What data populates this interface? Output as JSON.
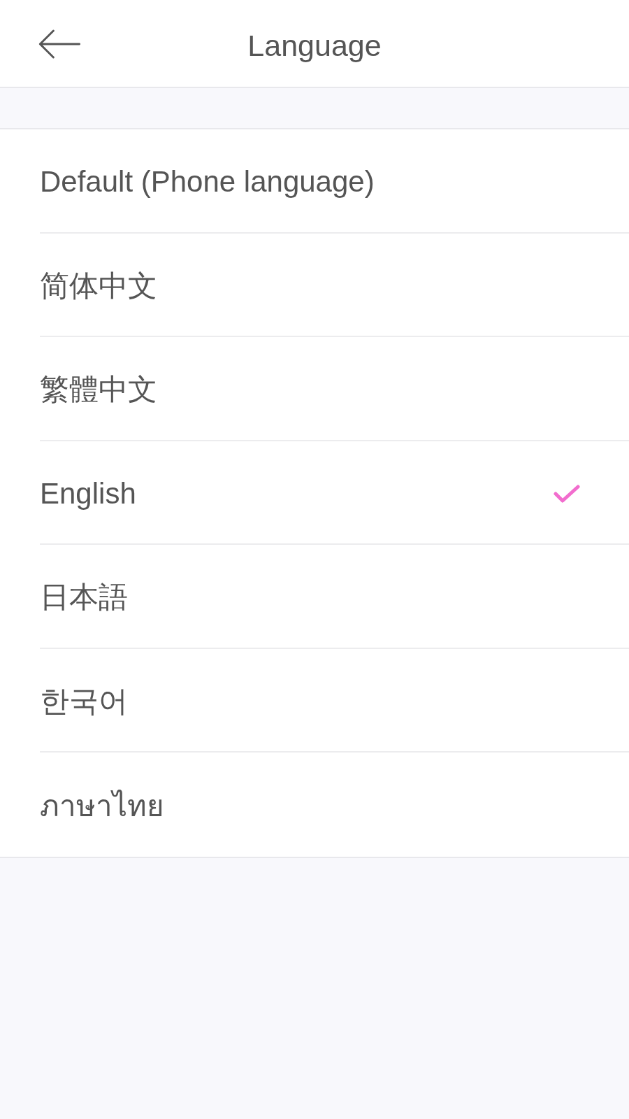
{
  "header": {
    "title": "Language"
  },
  "languages": [
    {
      "label": "Default (Phone language)",
      "selected": false
    },
    {
      "label": "简体中文",
      "selected": false
    },
    {
      "label": "繁體中文",
      "selected": false
    },
    {
      "label": "English",
      "selected": true
    },
    {
      "label": "日本語",
      "selected": false
    },
    {
      "label": "한국어",
      "selected": false
    },
    {
      "label": "ภาษาไทย",
      "selected": false
    }
  ]
}
